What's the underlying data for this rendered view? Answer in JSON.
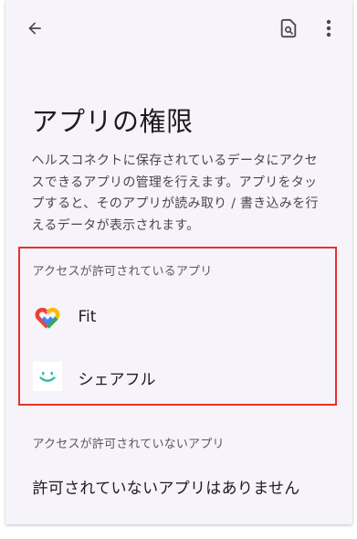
{
  "header": {
    "back_icon": "arrow-back-icon",
    "search_icon": "search-in-page-icon",
    "more_icon": "more-vert-icon"
  },
  "page": {
    "title": "アプリの権限",
    "description": "ヘルスコネクトに保存されているデータにアクセスできるアプリの管理を行えます。アプリをタップすると、そのアプリが読み取り / 書き込みを行えるデータが表示されます。"
  },
  "allowed": {
    "header": "アクセスが許可されているアプリ",
    "apps": [
      {
        "name": "Fit",
        "icon": "google-fit-icon"
      },
      {
        "name": "シェアフル",
        "icon": "sharefull-icon"
      }
    ]
  },
  "not_allowed": {
    "header": "アクセスが許可されていないアプリ",
    "empty_message": "許可されていないアプリはありません"
  },
  "colors": {
    "background": "#f7f3fa",
    "highlight_border": "#e8322a",
    "text_primary": "#1d1b20",
    "text_secondary": "#49454f"
  }
}
